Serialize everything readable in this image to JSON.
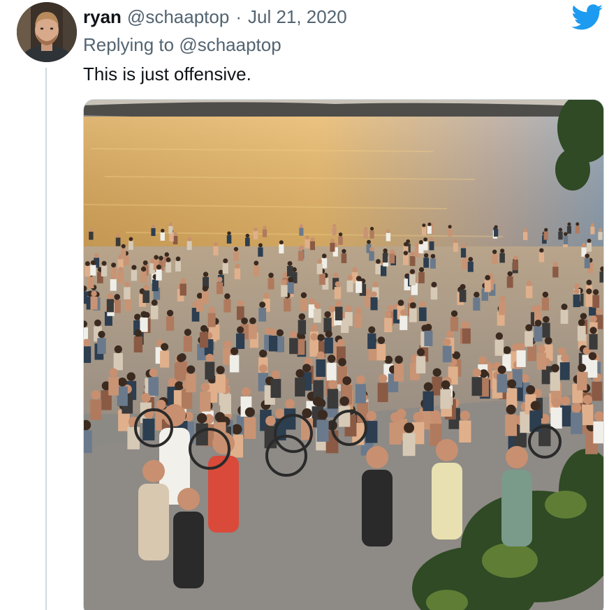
{
  "tweet": {
    "display_name": "ryan",
    "handle": "@schaaptop",
    "separator": "·",
    "date": "Jul 21, 2020",
    "replying_prefix": "Replying to",
    "replying_to": "@schaaptop",
    "text": "This is just offensive.",
    "avatar_icon": "user-avatar",
    "brand_icon": "twitter-bird-icon",
    "media_description_icon": "photo-icon"
  },
  "colors": {
    "brand": "#1d9bf0",
    "text_primary": "#0f1419",
    "text_secondary": "#536471",
    "border": "#cfd9de"
  }
}
